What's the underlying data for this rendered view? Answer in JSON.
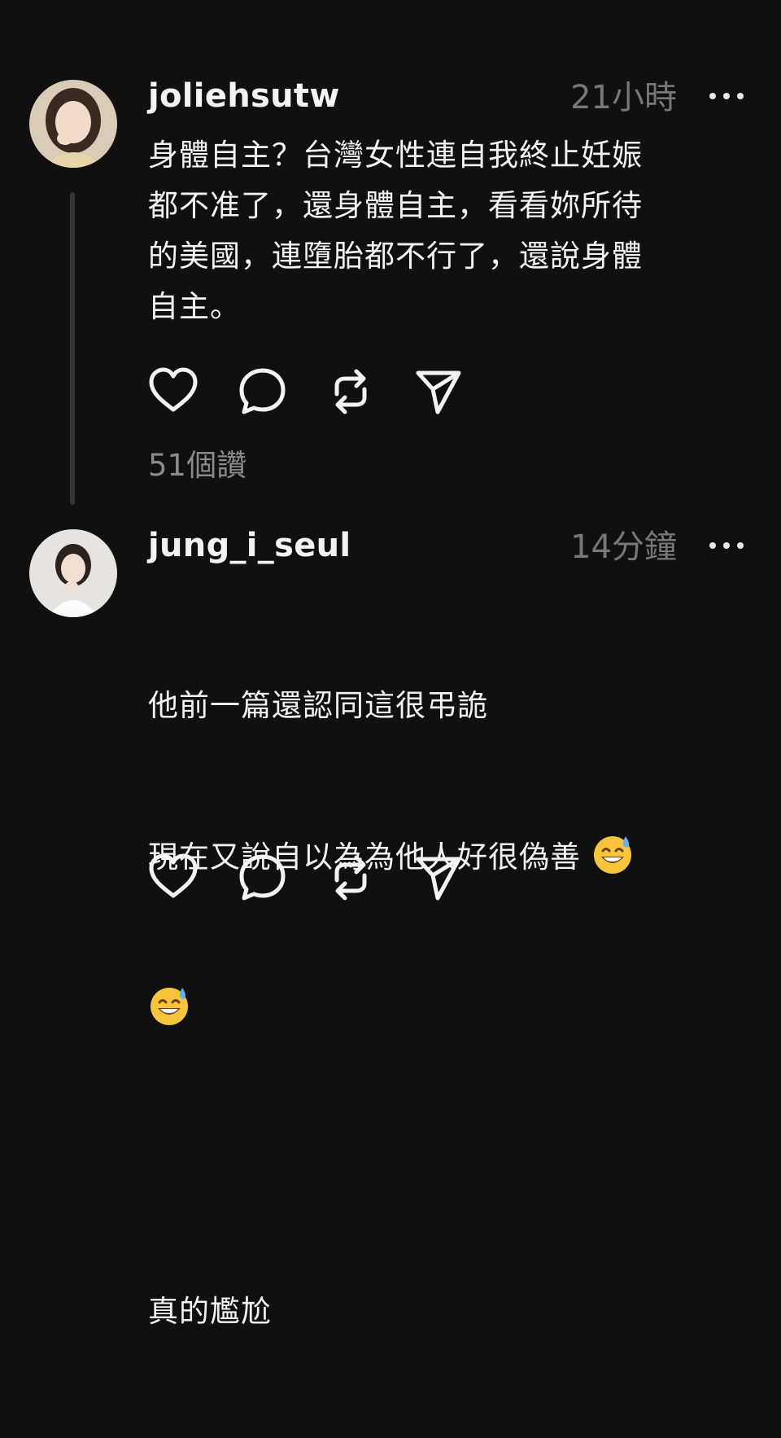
{
  "posts": [
    {
      "username": "joliehsutw",
      "time": "21小時",
      "text": "身體自主？台灣女性連自我終止妊娠\n都不准了，還身體自主，看看妳所待\n的美國，連墮胎都不行了，還說身體\n自主。",
      "likes": "51個讚"
    },
    {
      "username": "jung_i_seul",
      "time": "14分鐘",
      "text_line1": "他前一篇還認同這很弔詭",
      "text_line2": "現在又說自以為為他人好很偽善",
      "text_last": "真的尷尬"
    }
  ],
  "icons": {
    "like": "heart-icon",
    "reply": "comment-icon",
    "repost": "repost-icon",
    "share": "send-icon",
    "more": "more-icon",
    "emoji": "grinning-face-with-sweat-emoji"
  }
}
